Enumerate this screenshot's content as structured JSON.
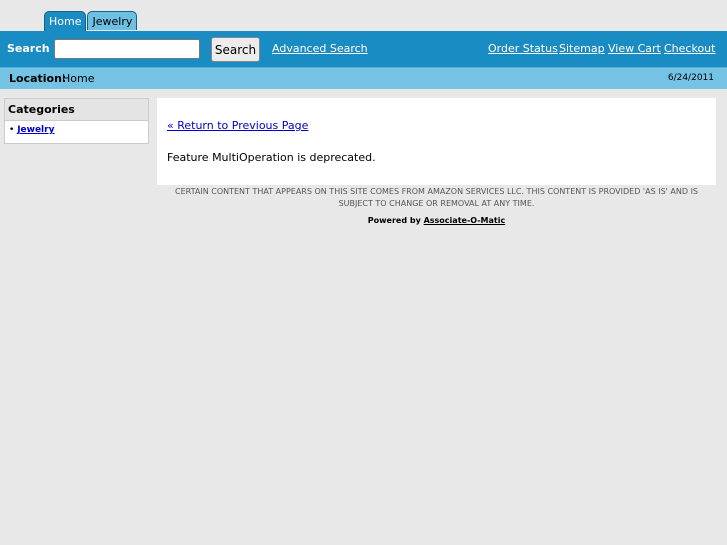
{
  "tabs": [
    {
      "label": "Home",
      "active": true
    },
    {
      "label": "Jewelry",
      "active": false
    }
  ],
  "search": {
    "label": "Search",
    "value": "",
    "button_label": "Search",
    "advanced_link": "Advanced Search"
  },
  "top_links": [
    "Order Status",
    "Sitemap",
    "View Cart",
    "Checkout"
  ],
  "location": {
    "label": "Location:",
    "value": "Home",
    "date": "6/24/2011"
  },
  "categories": {
    "title": "Categories",
    "items": [
      {
        "bullet": "•",
        "label": "Jewelry"
      }
    ]
  },
  "content": {
    "return_link": "« Return to Previous Page",
    "message": "Feature MultiOperation is deprecated."
  },
  "footer": {
    "disclaimer": "CERTAIN CONTENT THAT APPEARS ON THIS SITE COMES FROM AMAZON SERVICES LLC. THIS CONTENT IS PROVIDED 'AS IS' AND IS SUBJECT TO CHANGE OR REMOVAL AT ANY TIME.",
    "powered_prefix": "Powered by",
    "powered_link": "Associate-O-Matic"
  },
  "colors": {
    "header_blue": "#1a8cc4",
    "location_blue": "#74c2e4",
    "link_blue": "#0000cc",
    "page_background": "#e8e8e8"
  }
}
